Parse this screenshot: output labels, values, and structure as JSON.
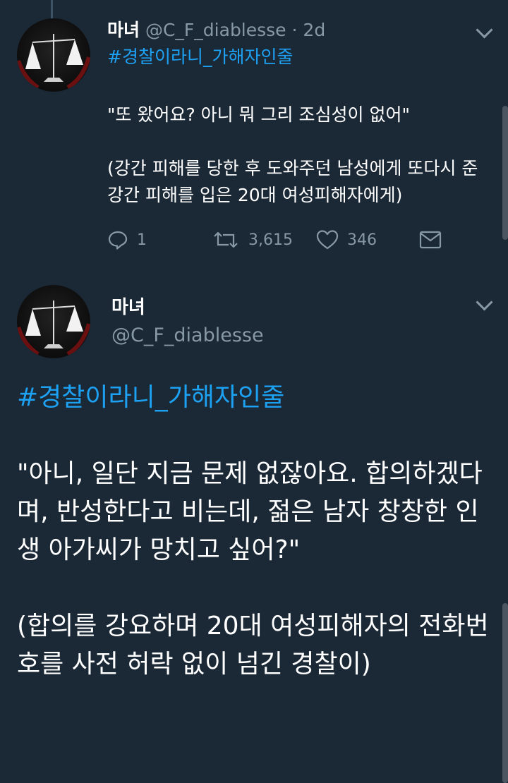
{
  "tweet1": {
    "name": "마녀",
    "handle": "@C_F_diablesse",
    "separator": " · ",
    "time": "2d",
    "hashtag": "#경찰이라니_가해자인줄",
    "quote": "\"또 왔어요? 아니 뭐 그리 조심성이 없어\"",
    "note": "(강간 피해를 당한 후 도와주던 남성에게 또다시 준강간 피해를 입은 20대 여성피해자에게)",
    "actions": {
      "replies": "1",
      "retweets": "3,615",
      "likes": "346"
    }
  },
  "tweet2": {
    "name": "마녀",
    "handle": "@C_F_diablesse",
    "hashtag": "#경찰이라니_가해자인줄",
    "quote": "\"아니, 일단 지금 문제 없잖아요. 합의하겠다며, 반성한다고 비는데, 젊은 남자 창창한 인생 아가씨가 망치고 싶어?\"",
    "note": "(합의를 강요하며 20대 여성피해자의 전화번호를 사전 허락 없이 넘긴 경찰이)"
  },
  "colors": {
    "background": "#1b2836",
    "accent": "#1da1f2",
    "muted": "#8899a6"
  }
}
